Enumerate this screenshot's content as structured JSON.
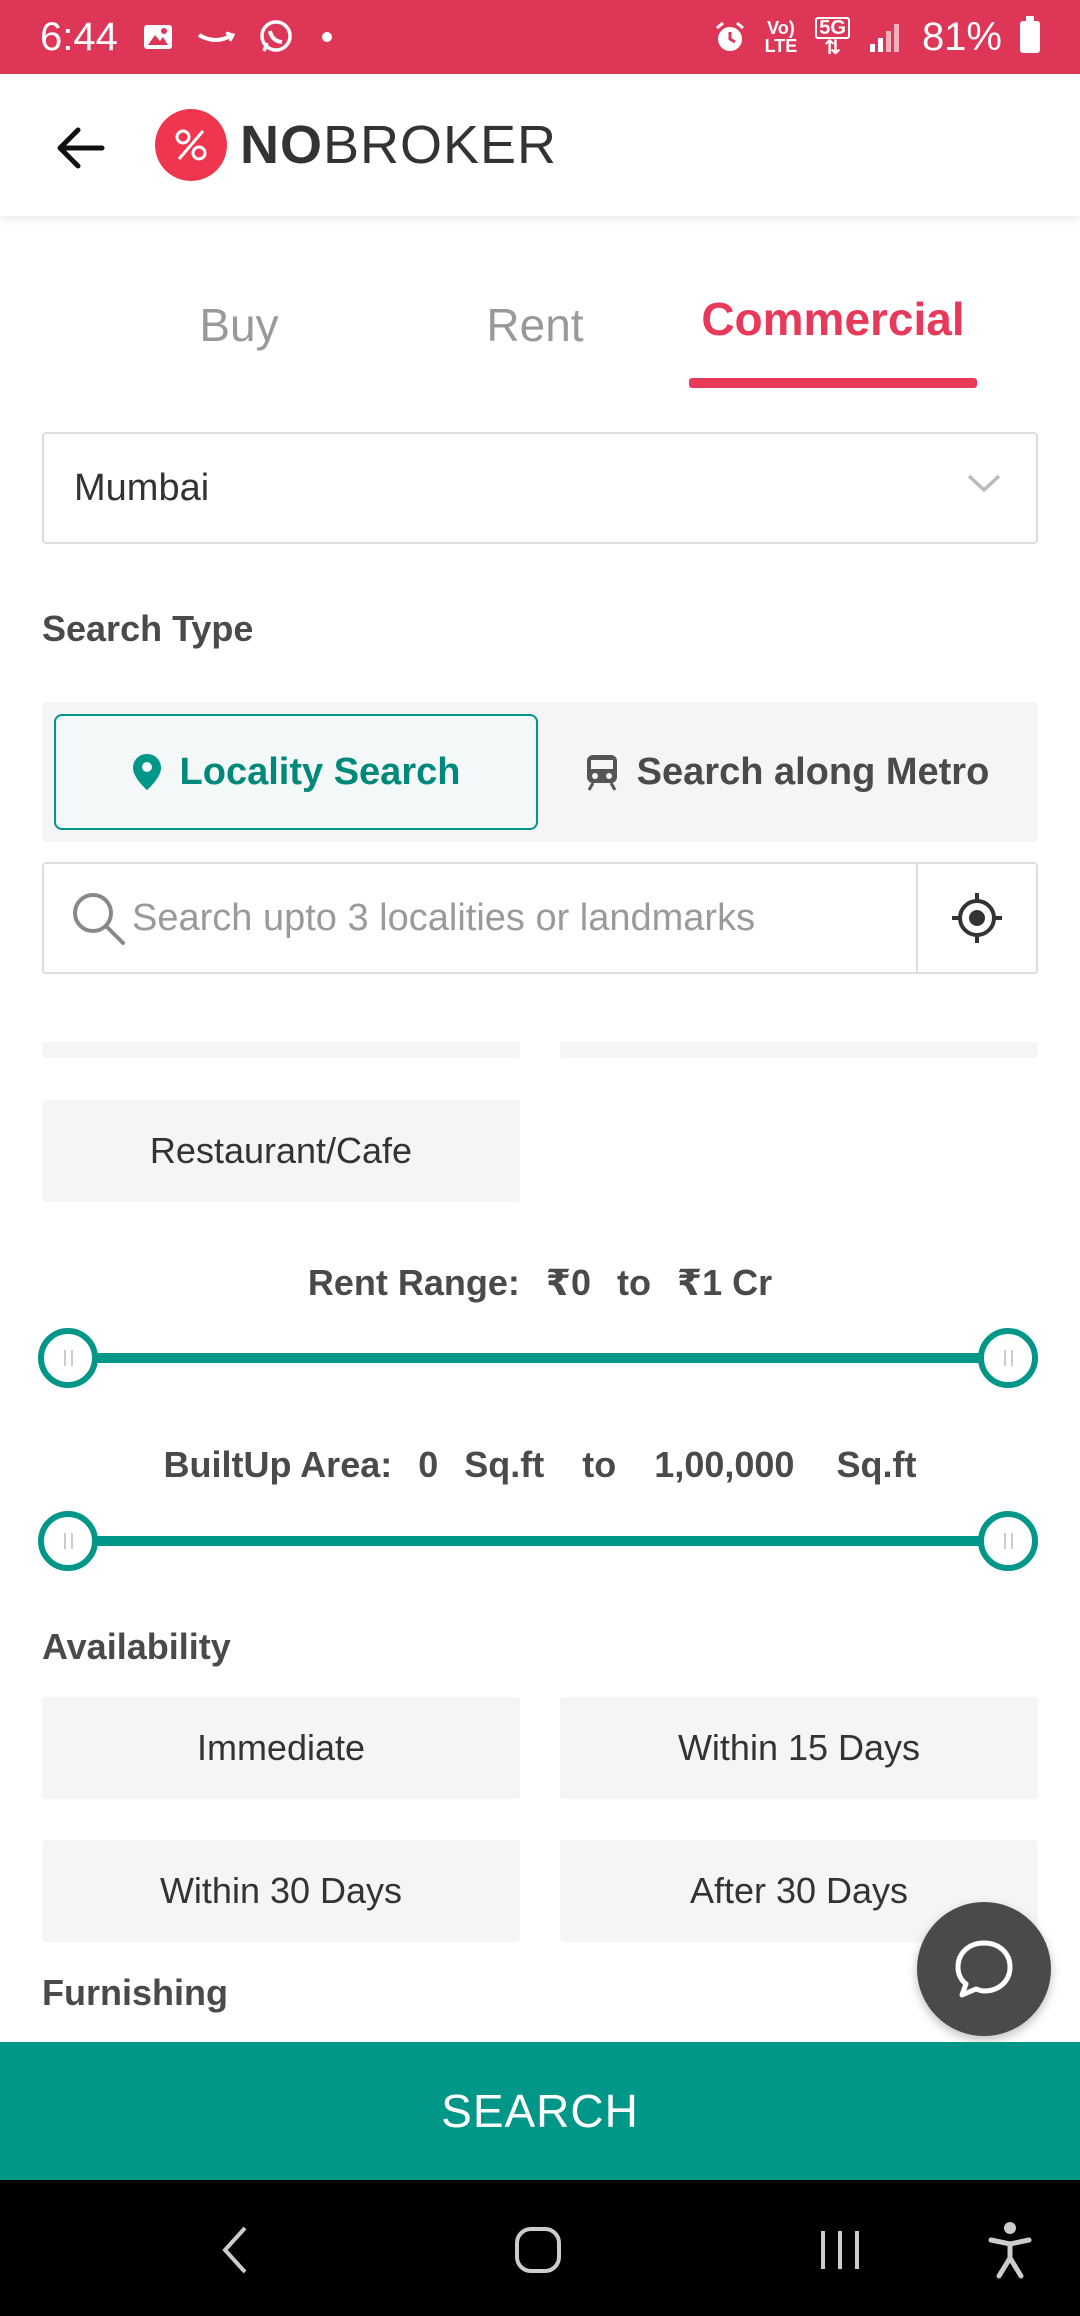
{
  "status_bar": {
    "time": "6:44",
    "net_top": "Vo)",
    "net_bottom": "LTE",
    "fiveg": "5G",
    "battery": "81%"
  },
  "header": {
    "logo_bold": "NO",
    "logo_rest": "BROKER"
  },
  "tabs": {
    "buy": "Buy",
    "rent": "Rent",
    "commercial": "Commercial",
    "active": "commercial"
  },
  "city": {
    "selected": "Mumbai"
  },
  "search_type": {
    "label": "Search Type",
    "locality": "Locality Search",
    "metro": "Search along Metro"
  },
  "search": {
    "placeholder": "Search upto 3 localities or landmarks"
  },
  "property_types": {
    "restaurant": "Restaurant/Cafe"
  },
  "rent_range": {
    "label": "Rent Range:",
    "min": "₹0",
    "to": "to",
    "max": "₹1 Cr"
  },
  "area_range": {
    "label": "BuiltUp Area:",
    "min_value": "0",
    "min_unit": "Sq.ft",
    "to": "to",
    "max_value": "1,00,000",
    "max_unit": "Sq.ft"
  },
  "availability": {
    "label": "Availability",
    "options": [
      "Immediate",
      "Within 15 Days",
      "Within 30 Days",
      "After 30 Days"
    ]
  },
  "furnishing": {
    "label": "Furnishing"
  },
  "search_button": "SEARCH",
  "colors": {
    "brand_red": "#e8395a",
    "teal": "#009688",
    "status_bar": "#de3656"
  }
}
